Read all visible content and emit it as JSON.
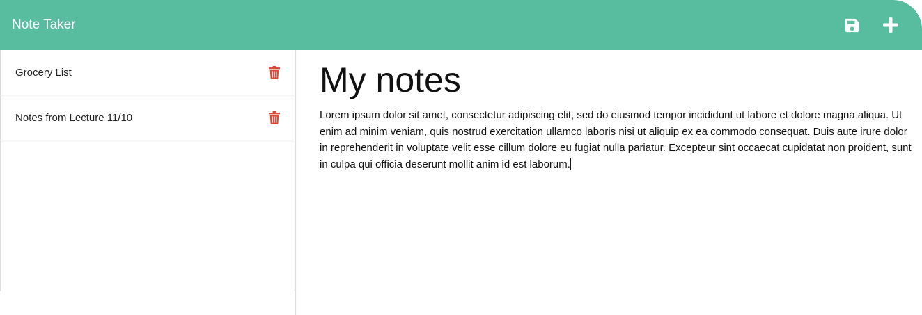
{
  "colors": {
    "navbar_bg": "#58bc9f",
    "delete_icon": "#dd4b39",
    "nav_icon": "#ffffff"
  },
  "navbar": {
    "brand": "Note Taker",
    "save_icon": "floppy-disk",
    "add_icon": "plus"
  },
  "sidebar": {
    "notes": [
      {
        "title": "Grocery List",
        "icon": "trash"
      },
      {
        "title": "Notes from Lecture 11/10",
        "icon": "trash"
      }
    ]
  },
  "main": {
    "title": "My notes",
    "body": "Lorem ipsum dolor sit amet, consectetur adipiscing elit, sed do eiusmod tempor incididunt ut labore et dolore magna aliqua. Ut enim ad minim veniam, quis nostrud exercitation ullamco laboris nisi ut aliquip ex ea commodo consequat. Duis aute irure dolor in reprehenderit in voluptate velit esse cillum dolore eu fugiat nulla pariatur. Excepteur sint occaecat cupidatat non proident, sunt in culpa qui officia deserunt mollit anim id est laborum."
  }
}
